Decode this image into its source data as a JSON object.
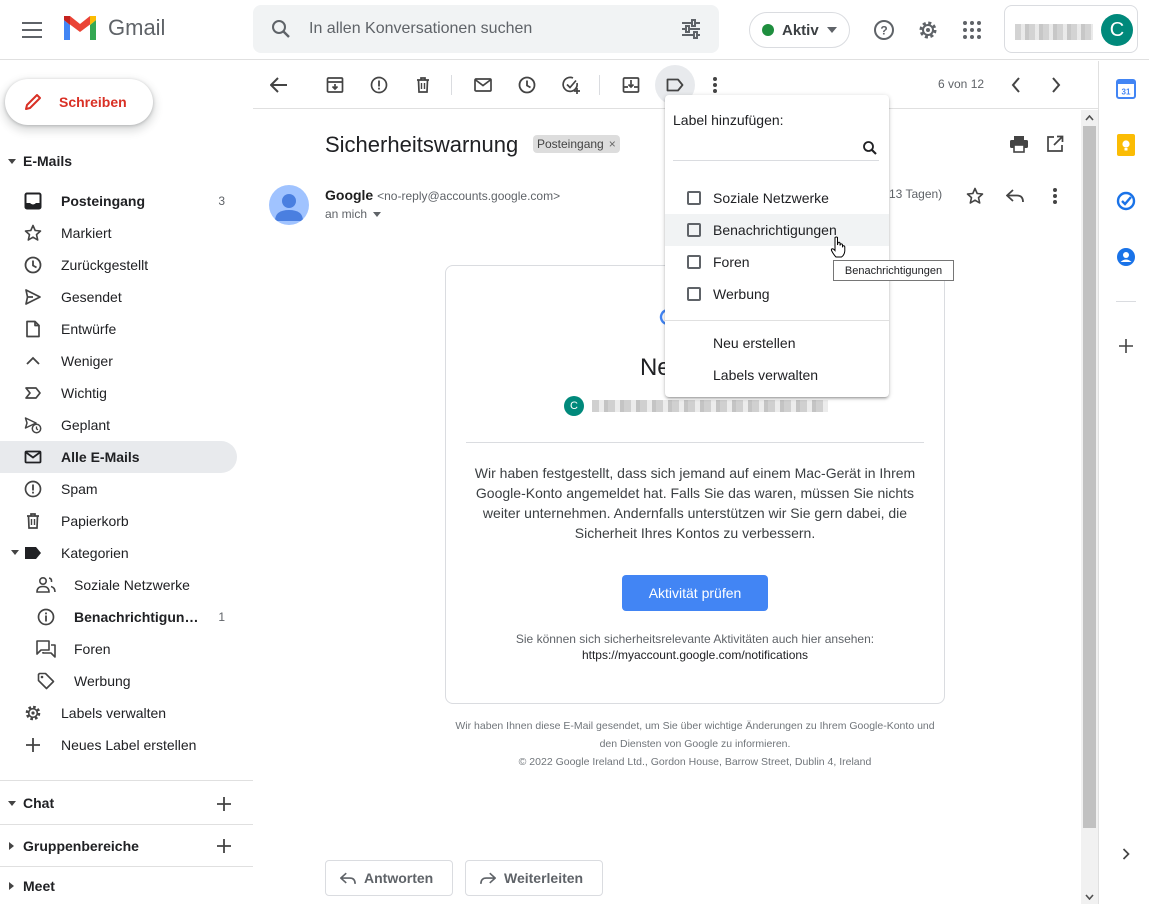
{
  "app": {
    "name": "Gmail",
    "search_placeholder": "In allen Konversationen suchen",
    "status": "Aktiv",
    "account_initial": "C"
  },
  "sidebar": {
    "compose": "Schreiben",
    "mail_section": "E-Mails",
    "items": [
      {
        "label": "Posteingang",
        "count": "3",
        "icon": "inbox-icon"
      },
      {
        "label": "Markiert",
        "count": "",
        "icon": "star-icon"
      },
      {
        "label": "Zurückgestellt",
        "count": "",
        "icon": "clock-icon"
      },
      {
        "label": "Gesendet",
        "count": "",
        "icon": "send-icon"
      },
      {
        "label": "Entwürfe",
        "count": "",
        "icon": "draft-icon"
      },
      {
        "label": "Weniger",
        "count": "",
        "icon": "chevron-up-icon"
      },
      {
        "label": "Wichtig",
        "count": "",
        "icon": "important-icon"
      },
      {
        "label": "Geplant",
        "count": "",
        "icon": "scheduled-icon"
      },
      {
        "label": "Alle E-Mails",
        "count": "",
        "icon": "all-mail-icon"
      },
      {
        "label": "Spam",
        "count": "",
        "icon": "spam-icon"
      },
      {
        "label": "Papierkorb",
        "count": "",
        "icon": "trash-icon"
      },
      {
        "label": "Kategorien",
        "count": "",
        "icon": "label-icon"
      }
    ],
    "categories": [
      {
        "label": "Soziale Netzwerke",
        "count": "",
        "icon": "people-icon"
      },
      {
        "label": "Benachrichtigungen",
        "count": "1",
        "icon": "info-icon"
      },
      {
        "label": "Foren",
        "count": "",
        "icon": "forum-icon"
      },
      {
        "label": "Werbung",
        "count": "",
        "icon": "tag-icon"
      }
    ],
    "manage_labels": "Labels verwalten",
    "new_label": "Neues Label erstellen",
    "chat": "Chat",
    "spaces": "Gruppenbereiche",
    "meet": "Meet"
  },
  "toolbar": {
    "pager": "6 von 12"
  },
  "message": {
    "subject": "Sicherheitswarnung",
    "chip": "Posteingang",
    "sender_name": "Google",
    "sender_email": "<no-reply@accounts.google.com>",
    "to": "an mich",
    "date": "13 Tagen)",
    "card_title": "Neue Anm",
    "body": "Wir haben festgestellt, dass sich jemand auf einem Mac-Gerät in Ihrem Google-Konto angemeldet hat. Falls Sie das waren, müssen Sie nichts weiter unternehmen. Andernfalls unterstützen wir Sie gern dabei, die Sicherheit Ihres Kontos zu verbessern.",
    "cta": "Aktivität prüfen",
    "foot_line1": "Sie können sich sicherheitsrelevante Aktivitäten auch hier ansehen:",
    "foot_link": "https://myaccount.google.com/notifications",
    "legal_line1": "Wir haben Ihnen diese E-Mail gesendet, um Sie über wichtige Änderungen zu Ihrem Google-Konto und",
    "legal_line2": "den Diensten von Google zu informieren.",
    "legal_line3": "© 2022 Google Ireland Ltd., Gordon House, Barrow Street, Dublin 4, Ireland",
    "reply": "Antworten",
    "forward": "Weiterleiten"
  },
  "label_menu": {
    "title": "Label hinzufügen:",
    "options": [
      "Soziale Netzwerke",
      "Benachrichtigungen",
      "Foren",
      "Werbung"
    ],
    "create": "Neu erstellen",
    "manage": "Labels verwalten",
    "tooltip": "Benachrichtigungen"
  },
  "colors": {
    "accent_blue": "#4285f4",
    "compose_red": "#d93025",
    "active_green": "#1e8e3e",
    "avatar_teal": "#00897b"
  }
}
